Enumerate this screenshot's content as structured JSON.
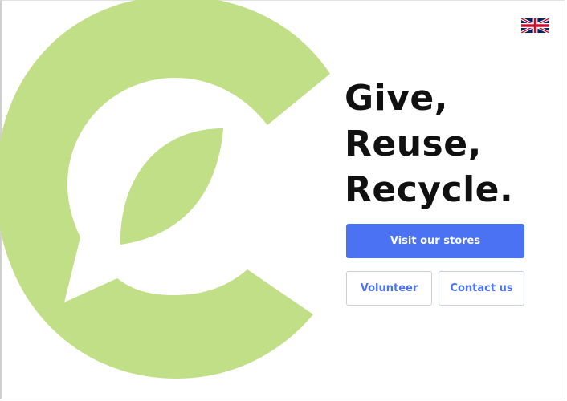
{
  "language": {
    "icon": "uk-flag-icon",
    "label": "English"
  },
  "brand": {
    "icon": "leaf-c-logo-icon",
    "color": "#c0df86"
  },
  "hero": {
    "lines": [
      "Give,",
      "Reuse,",
      "Recycle."
    ]
  },
  "actions": {
    "primary_label": "Visit our stores",
    "volunteer_label": "Volunteer",
    "contact_label": "Contact us"
  },
  "colors": {
    "accent": "#4a72f2",
    "text": "#101010",
    "background": "#ffffff"
  }
}
